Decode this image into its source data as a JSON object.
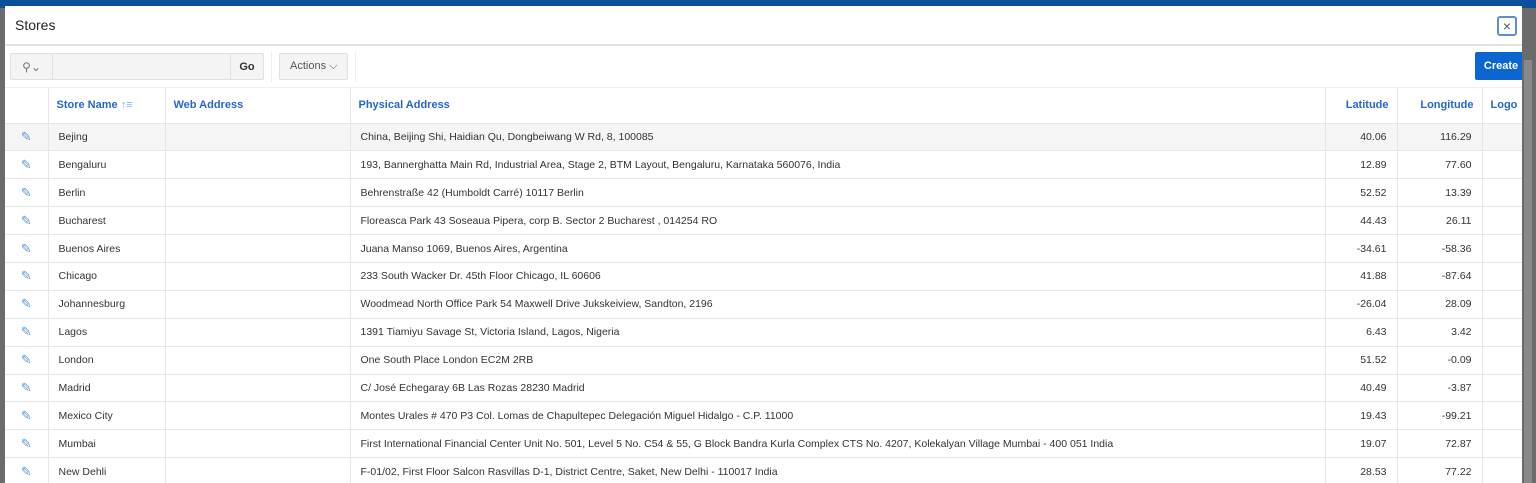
{
  "dialog": {
    "title": "Stores",
    "close_label": "×"
  },
  "toolbar": {
    "search_icon": "search-icon",
    "search_value": "",
    "go_label": "Go",
    "actions_label": "Actions ⌵",
    "create_label": "Create"
  },
  "table": {
    "columns": [
      "Store Name",
      "Web Address",
      "Physical Address",
      "Latitude",
      "Longitude",
      "Logo"
    ],
    "sort_indicator": "↑≡",
    "rows": [
      {
        "name": "Bejing",
        "web": "",
        "address": "China, Beijing Shi, Haidian Qu, Dongbeiwang W Rd, 8, 100085",
        "lat": "40.06",
        "lon": "116.29"
      },
      {
        "name": "Bengaluru",
        "web": "",
        "address": "193, Bannerghatta Main Rd, Industrial Area, Stage 2, BTM Layout, Bengaluru, Karnataka 560076, India",
        "lat": "12.89",
        "lon": "77.60"
      },
      {
        "name": "Berlin",
        "web": "",
        "address": "Behrenstraße 42 (Humboldt Carré) 10117 Berlin",
        "lat": "52.52",
        "lon": "13.39"
      },
      {
        "name": "Bucharest",
        "web": "",
        "address": "Floreasca Park 43 Soseaua Pipera, corp B. Sector 2 Bucharest , 014254 RO",
        "lat": "44.43",
        "lon": "26.11"
      },
      {
        "name": "Buenos Aires",
        "web": "",
        "address": "Juana Manso 1069, Buenos Aires, Argentina",
        "lat": "-34.61",
        "lon": "-58.36"
      },
      {
        "name": "Chicago",
        "web": "",
        "address": "233 South Wacker Dr. 45th Floor Chicago, IL 60606",
        "lat": "41.88",
        "lon": "-87.64"
      },
      {
        "name": "Johannesburg",
        "web": "",
        "address": "Woodmead North Office Park 54 Maxwell Drive Jukskeiview, Sandton, 2196",
        "lat": "-26.04",
        "lon": "28.09"
      },
      {
        "name": "Lagos",
        "web": "",
        "address": "1391 Tiamiyu Savage St, Victoria Island, Lagos, Nigeria",
        "lat": "6.43",
        "lon": "3.42"
      },
      {
        "name": "London",
        "web": "",
        "address": "One South Place London EC2M 2RB",
        "lat": "51.52",
        "lon": "-0.09"
      },
      {
        "name": "Madrid",
        "web": "",
        "address": "C/ José Echegaray 6B Las Rozas 28230 Madrid",
        "lat": "40.49",
        "lon": "-3.87"
      },
      {
        "name": "Mexico City",
        "web": "",
        "address": "Montes Urales # 470 P3 Col. Lomas de Chapultepec Delegación Miguel Hidalgo - C.P. 11000",
        "lat": "19.43",
        "lon": "-99.21"
      },
      {
        "name": "Mumbai",
        "web": "",
        "address": "First International Financial Center Unit No. 501, Level 5 No. C54 & 55, G Block Bandra Kurla Complex CTS No. 4207, Kolekalyan Village Mumbai - 400 051 India",
        "lat": "19.07",
        "lon": "72.87"
      },
      {
        "name": "New Dehli",
        "web": "",
        "address": "F-01/02, First Floor Salcon Rasvillas D-1, District Centre, Saket, New Delhi - 110017 India",
        "lat": "28.53",
        "lon": "77.22"
      }
    ]
  },
  "colors": {
    "accent": "#0b66d1",
    "header_text": "#2567c8",
    "top_bar": "#0a4f9a"
  }
}
